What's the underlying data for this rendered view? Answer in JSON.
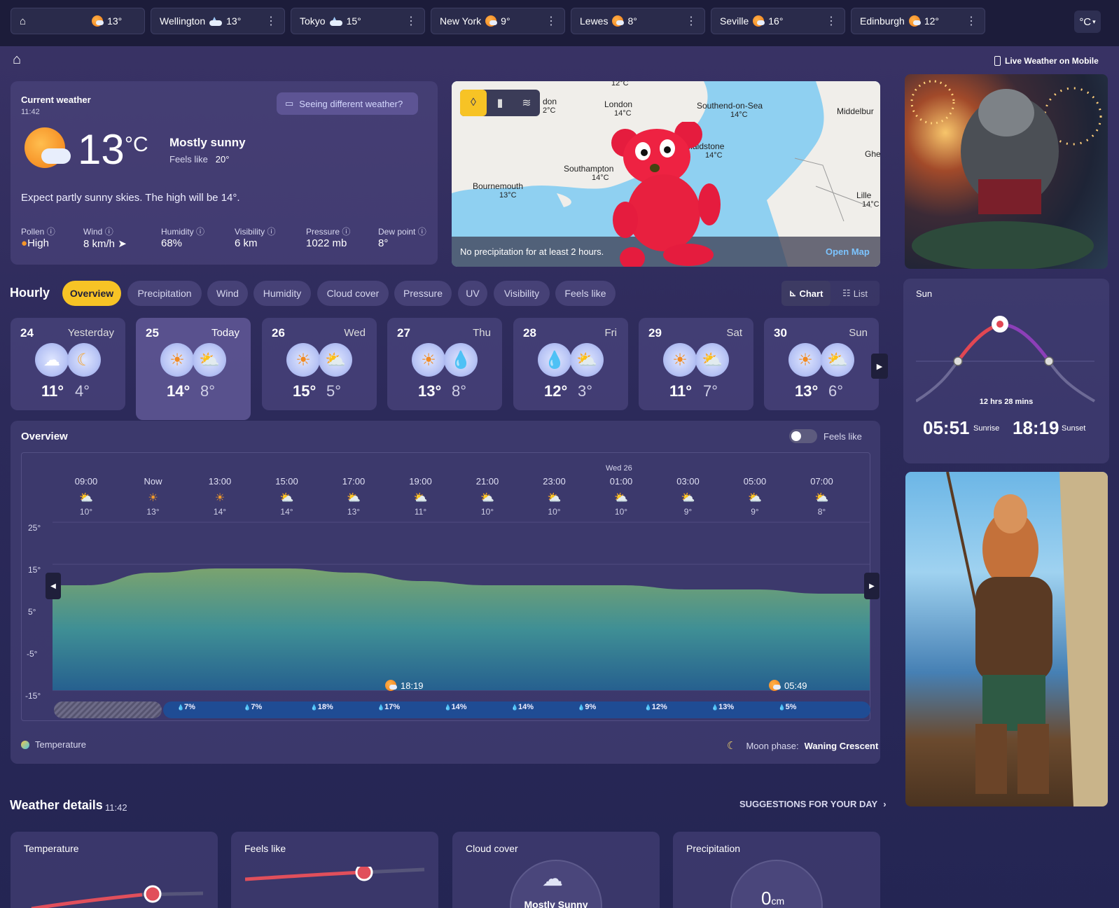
{
  "tabs": [
    {
      "label": "",
      "temp": "13°",
      "icon": "sun-cloud"
    },
    {
      "label": "Wellington",
      "temp": "13°",
      "icon": "cloud-sun"
    },
    {
      "label": "Tokyo",
      "temp": "15°",
      "icon": "cloud-sun"
    },
    {
      "label": "New York",
      "temp": "9°",
      "icon": "sun-cloud"
    },
    {
      "label": "Lewes",
      "temp": "8°",
      "icon": "sun-cloud"
    },
    {
      "label": "Seville",
      "temp": "16°",
      "icon": "sun-cloud"
    },
    {
      "label": "Edinburgh",
      "temp": "12°",
      "icon": "sun-cloud"
    }
  ],
  "unit_toggle": "°C",
  "live_mobile": "Live Weather on Mobile",
  "current": {
    "title": "Current weather",
    "time": "11:42",
    "temp": "13",
    "unit": "°C",
    "condition": "Mostly sunny",
    "feels_label": "Feels like",
    "feels": "20°",
    "seeing": "Seeing different weather?",
    "summary": "Expect partly sunny skies. The high will be 14°.",
    "stats": [
      {
        "label": "Pollen",
        "value": "High"
      },
      {
        "label": "Wind",
        "value": "8 km/h"
      },
      {
        "label": "Humidity",
        "value": "68%"
      },
      {
        "label": "Visibility",
        "value": "6 km"
      },
      {
        "label": "Pressure",
        "value": "1022 mb"
      },
      {
        "label": "Dew point",
        "value": "8°"
      }
    ]
  },
  "map": {
    "labels": [
      {
        "name": "London",
        "temp": "14°C"
      },
      {
        "name": "Southend-on-Sea",
        "temp": "14°C"
      },
      {
        "name": "Maidstone",
        "temp": "14°C"
      },
      {
        "name": "Southampton",
        "temp": "14°C"
      },
      {
        "name": "Bournemouth",
        "temp": "13°C"
      },
      {
        "name": "Lille",
        "temp": "14°C"
      },
      {
        "name": "Middelbur",
        "temp": ""
      },
      {
        "name": "Ghe",
        "temp": ""
      },
      {
        "name": "don",
        "temp": "2°C"
      },
      {
        "name": "",
        "temp": "12°C"
      }
    ],
    "footer": "No precipitation for at least 2 hours.",
    "open": "Open Map"
  },
  "hourly": {
    "title": "Hourly",
    "tabs": [
      "Overview",
      "Precipitation",
      "Wind",
      "Humidity",
      "Cloud cover",
      "Pressure",
      "UV",
      "Visibility",
      "Feels like"
    ],
    "chart_label": "Chart",
    "list_label": "List"
  },
  "days": [
    {
      "num": "24",
      "name": "Yesterday",
      "hi": "11°",
      "lo": "4°"
    },
    {
      "num": "25",
      "name": "Today",
      "hi": "14°",
      "lo": "8°"
    },
    {
      "num": "26",
      "name": "Wed",
      "hi": "15°",
      "lo": "5°"
    },
    {
      "num": "27",
      "name": "Thu",
      "hi": "13°",
      "lo": "8°"
    },
    {
      "num": "28",
      "name": "Fri",
      "hi": "12°",
      "lo": "3°"
    },
    {
      "num": "29",
      "name": "Sat",
      "hi": "11°",
      "lo": "7°"
    },
    {
      "num": "30",
      "name": "Sun",
      "hi": "13°",
      "lo": "6°"
    }
  ],
  "overview": {
    "title": "Overview",
    "feels_toggle": "Feels like",
    "date_marker": "Wed 26",
    "sunset_marker": "18:19",
    "sunrise_marker": "05:49",
    "legend": "Temperature",
    "moon_label": "Moon phase:",
    "moon_value": "Waning Crescent"
  },
  "chart_data": {
    "type": "area",
    "x": [
      "09:00",
      "Now",
      "13:00",
      "15:00",
      "17:00",
      "19:00",
      "21:00",
      "23:00",
      "01:00",
      "03:00",
      "05:00",
      "07:00"
    ],
    "values": [
      10,
      13,
      14,
      14,
      13,
      11,
      10,
      10,
      10,
      9,
      9,
      8
    ],
    "ylim": [
      -15,
      25
    ],
    "yticks": [
      "25°",
      "15°",
      "5°",
      "-5°",
      "-15°"
    ],
    "precip": [
      "7%",
      "7%",
      "18%",
      "17%",
      "14%",
      "14%",
      "9%",
      "12%",
      "13%",
      "5%"
    ]
  },
  "sun": {
    "title": "Sun",
    "duration": "12 hrs 28 mins",
    "sunrise": "05:51",
    "sunrise_label": "Sunrise",
    "sunset": "18:19",
    "sunset_label": "Sunset"
  },
  "details": {
    "title": "Weather details",
    "time": "11:42",
    "suggest": "SUGGESTIONS FOR YOUR DAY",
    "cards": [
      {
        "title": "Temperature",
        "text": ""
      },
      {
        "title": "Feels like",
        "text": ""
      },
      {
        "title": "Cloud cover",
        "text": "Mostly Sunny"
      },
      {
        "title": "Precipitation",
        "text": "0",
        "unit": "cm"
      }
    ]
  }
}
